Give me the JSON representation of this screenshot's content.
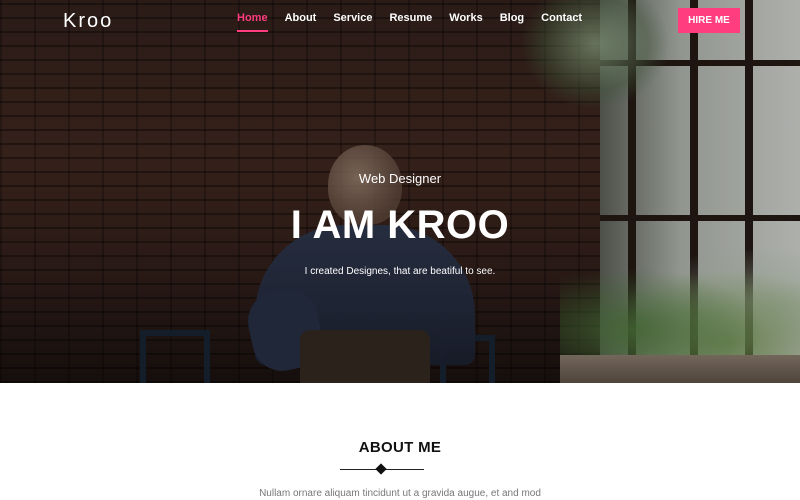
{
  "brand": {
    "logo": "Kroo"
  },
  "nav": {
    "items": [
      {
        "label": "Home",
        "active": true
      },
      {
        "label": "About"
      },
      {
        "label": "Service"
      },
      {
        "label": "Resume"
      },
      {
        "label": "Works"
      },
      {
        "label": "Blog"
      },
      {
        "label": "Contact"
      }
    ],
    "cta_label": "HIRE ME"
  },
  "hero": {
    "subtitle": "Web Designer",
    "title": "I AM KROO",
    "tagline": "I created Designes, that are beatiful to see."
  },
  "about": {
    "title": "ABOUT ME",
    "text": "Nullam ornare aliquam tincidunt ut a gravida augue, et and mod"
  },
  "colors": {
    "accent": "#ff3d7f",
    "hero_text": "#ffffff",
    "heading": "#111111",
    "body_text": "#777777"
  }
}
